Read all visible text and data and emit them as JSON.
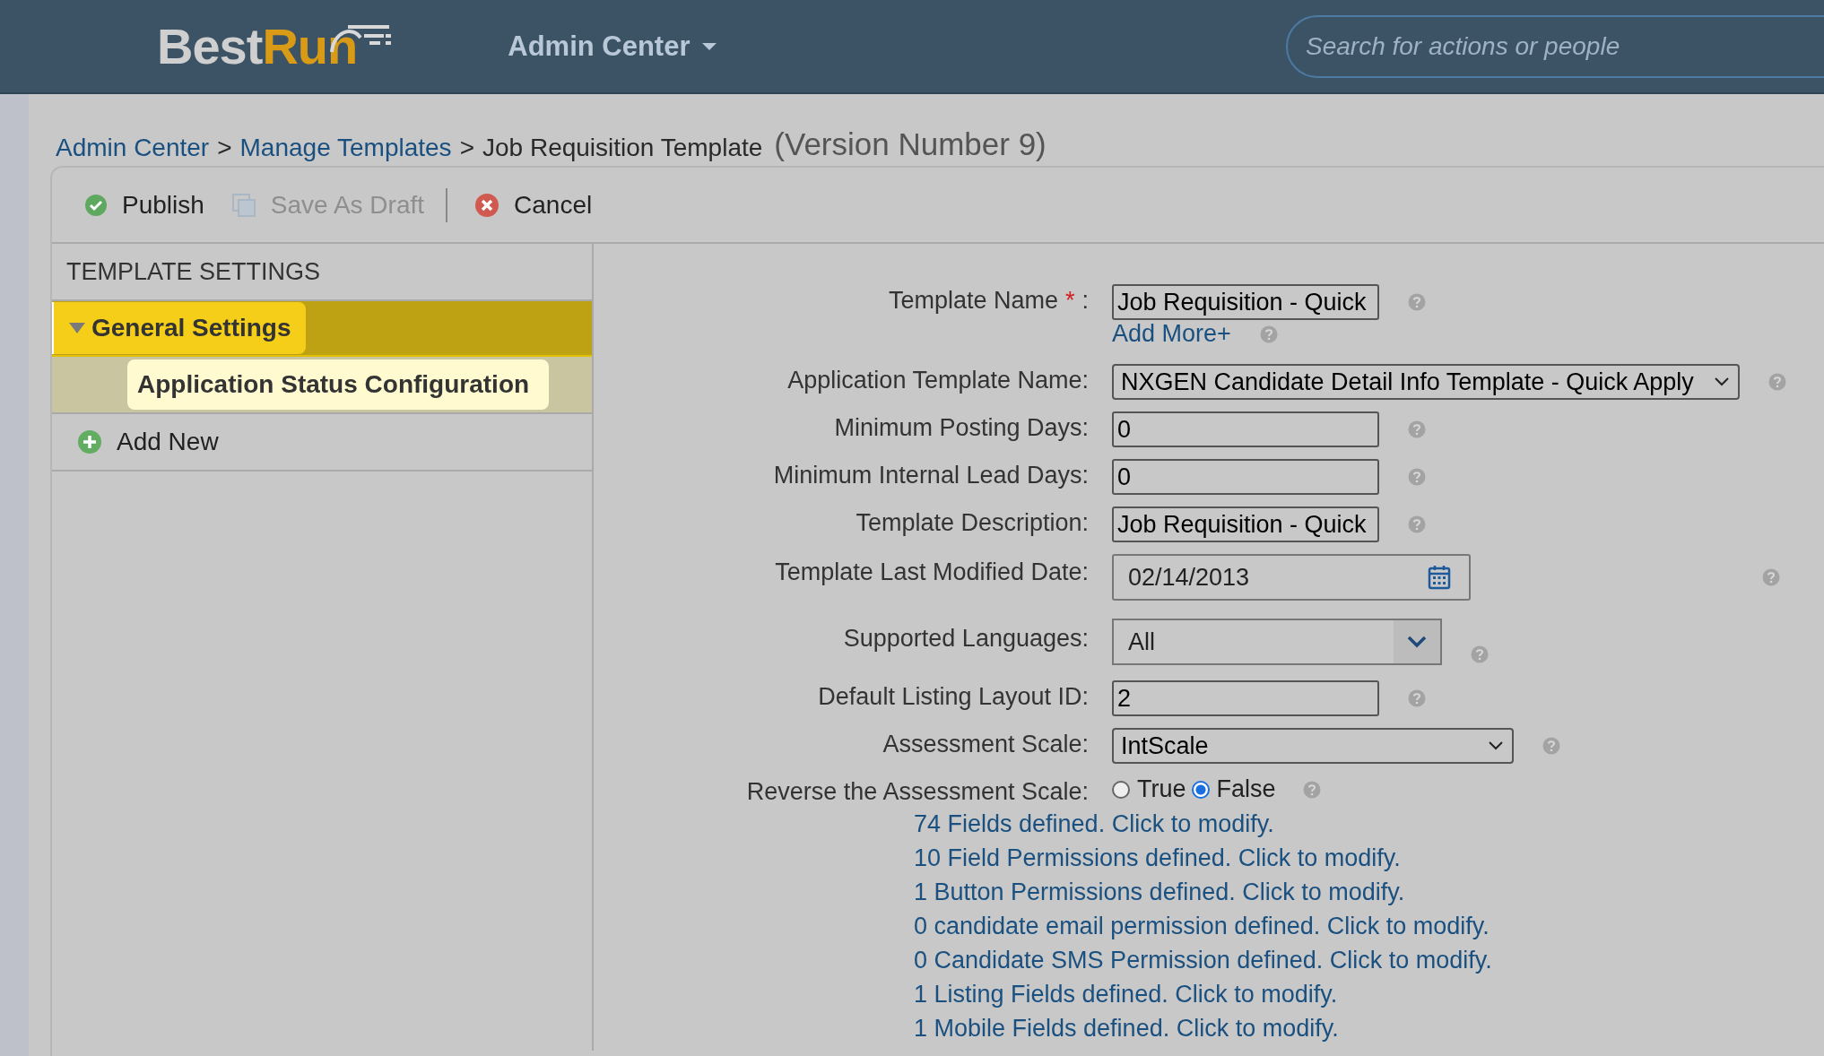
{
  "header": {
    "logo": {
      "first": "Best",
      "second": "Run"
    },
    "menu": "Admin Center",
    "search": {
      "placeholder": "Search for actions or people"
    }
  },
  "breadcrumb": {
    "items": [
      {
        "label": "Admin Center",
        "kind": "link"
      },
      {
        "label": "Manage Templates",
        "kind": "link"
      },
      {
        "label": "Job Requisition Template",
        "kind": "current"
      }
    ],
    "separator": ">",
    "version": "(Version Number 9)"
  },
  "toolbar": [
    {
      "label": "Publish",
      "kind": "publish",
      "disabled": false
    },
    {
      "label": "Save As Draft",
      "kind": "draft",
      "disabled": true
    },
    {
      "label": "Cancel",
      "kind": "cancel",
      "disabled": false
    }
  ],
  "sidebar": {
    "heading": "TEMPLATE SETTINGS",
    "items": [
      {
        "label": "General Settings",
        "expanded": true,
        "selected": true,
        "children": [
          {
            "label": "Application Status Configuration",
            "selected": false
          }
        ]
      }
    ],
    "add_button": "Add New"
  },
  "form": {
    "fields": [
      {
        "kind": "text",
        "label": "Template Name",
        "required_mark": "*",
        "label_end": ":",
        "value": "Job Requisition - Quick",
        "help": true,
        "extra_link": "Add More+"
      },
      {
        "kind": "select",
        "label": "Application Template Name:",
        "value": "NXGEN Candidate Detail Info Template - Quick Apply",
        "help": true,
        "wide": true
      },
      {
        "kind": "text",
        "label": "Minimum Posting Days:",
        "value": "0",
        "help": true
      },
      {
        "kind": "text",
        "label": "Minimum Internal Lead Days:",
        "value": "0",
        "help": true
      },
      {
        "kind": "text",
        "label": "Template Description:",
        "value": "Job Requisition - Quick",
        "help": true
      },
      {
        "kind": "date",
        "label": "Template Last Modified Date:",
        "value": "02/14/2013",
        "help": true
      },
      {
        "kind": "combo",
        "label": "Supported Languages:",
        "value": "All",
        "help": true
      },
      {
        "kind": "text",
        "label": "Default Listing Layout ID:",
        "value": "2",
        "help": true
      },
      {
        "kind": "select",
        "label": "Assessment Scale:",
        "value": "IntScale",
        "help": true,
        "wide": false
      },
      {
        "kind": "radio",
        "label": "Reverse the Assessment Scale:",
        "help": true,
        "options": [
          {
            "label": "True",
            "selected": false
          },
          {
            "label": "False",
            "selected": true
          }
        ]
      }
    ],
    "links": [
      "74 Fields defined. Click to modify.",
      "10 Field Permissions defined. Click to modify.",
      "1 Button Permissions defined. Click to modify.",
      "0 candidate email permission defined. Click to modify.",
      "0 Candidate SMS Permission defined. Click to modify.",
      "1 Listing Fields defined. Click to modify.",
      "1 Mobile Fields defined. Click to modify."
    ]
  }
}
